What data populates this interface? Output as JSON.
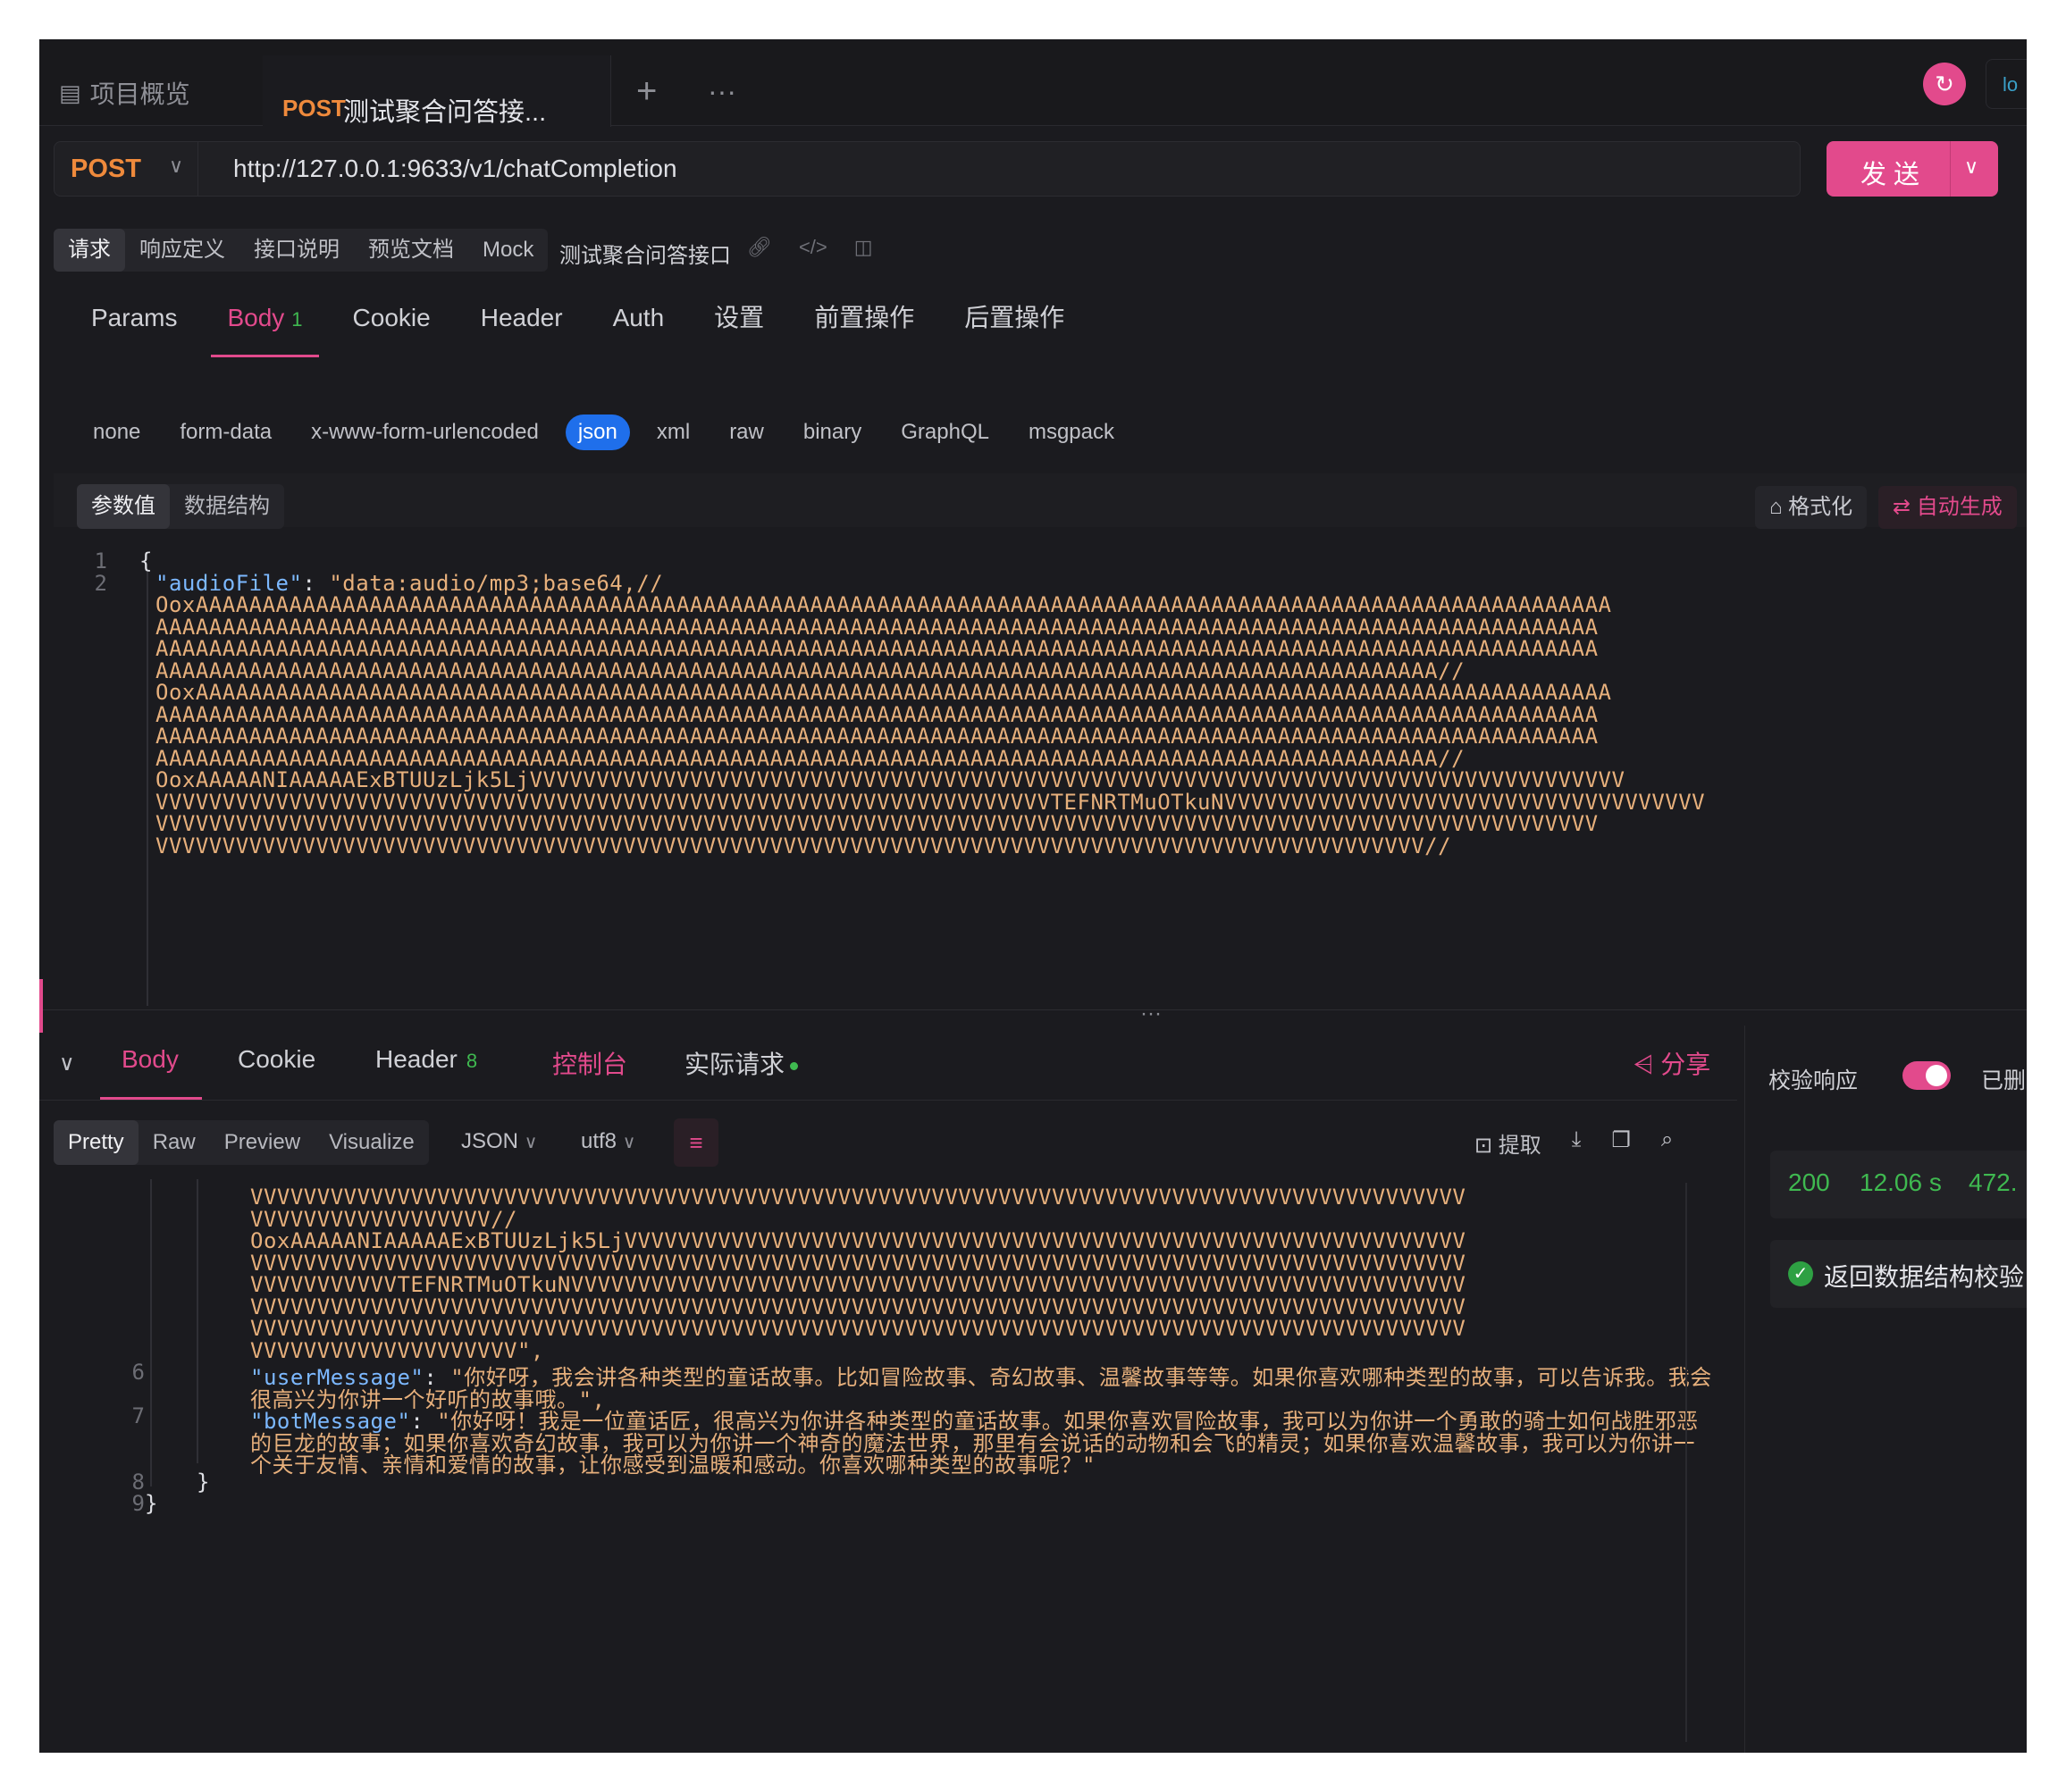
{
  "tabs": {
    "overview": "项目概览",
    "active_method": "POST",
    "active_title": "测试聚合问答接..."
  },
  "request": {
    "method": "POST",
    "url": "http://127.0.0.1:9633/v1/chatCompletion",
    "send_label": "发送"
  },
  "subtabs": [
    "请求",
    "响应定义",
    "接口说明",
    "预览文档",
    "Mock"
  ],
  "api_name": "测试聚合问答接口",
  "request_tabs": [
    {
      "label": "Params"
    },
    {
      "label": "Body",
      "count": "1"
    },
    {
      "label": "Cookie"
    },
    {
      "label": "Header"
    },
    {
      "label": "Auth"
    },
    {
      "label": "设置"
    },
    {
      "label": "前置操作"
    },
    {
      "label": "后置操作"
    }
  ],
  "body_types": [
    "none",
    "form-data",
    "x-www-form-urlencoded",
    "json",
    "xml",
    "raw",
    "binary",
    "GraphQL",
    "msgpack"
  ],
  "param_tabs": [
    "参数值",
    "数据结构"
  ],
  "format_label": "格式化",
  "auto_label": "自动生成",
  "request_code": [
    {
      "n": "1",
      "text": "{"
    },
    {
      "n": "2",
      "key": "\"audioFile\"",
      "sep": ": ",
      "text": "\"data:audio/mp3;base64,//"
    },
    {
      "n": "",
      "text": "OoxAAAAAAAAAAAAAAAAAAAAAAAAAAAAAAAAAAAAAAAAAAAAAAAAAAAAAAAAAAAAAAAAAAAAAAAAAAAAAAAAAAAAAAAAAAAAAAAAAAAAAAAAAA"
    },
    {
      "n": "",
      "text": "AAAAAAAAAAAAAAAAAAAAAAAAAAAAAAAAAAAAAAAAAAAAAAAAAAAAAAAAAAAAAAAAAAAAAAAAAAAAAAAAAAAAAAAAAAAAAAAAAAAAAAAAAAAA"
    },
    {
      "n": "",
      "text": "AAAAAAAAAAAAAAAAAAAAAAAAAAAAAAAAAAAAAAAAAAAAAAAAAAAAAAAAAAAAAAAAAAAAAAAAAAAAAAAAAAAAAAAAAAAAAAAAAAAAAAAAAAAA"
    },
    {
      "n": "",
      "text": "AAAAAAAAAAAAAAAAAAAAAAAAAAAAAAAAAAAAAAAAAAAAAAAAAAAAAAAAAAAAAAAAAAAAAAAAAAAAAAAAAAAAAAAAAAAAAAAA//"
    },
    {
      "n": "",
      "text": "OoxAAAAAAAAAAAAAAAAAAAAAAAAAAAAAAAAAAAAAAAAAAAAAAAAAAAAAAAAAAAAAAAAAAAAAAAAAAAAAAAAAAAAAAAAAAAAAAAAAAAAAAAAAA"
    },
    {
      "n": "",
      "text": "AAAAAAAAAAAAAAAAAAAAAAAAAAAAAAAAAAAAAAAAAAAAAAAAAAAAAAAAAAAAAAAAAAAAAAAAAAAAAAAAAAAAAAAAAAAAAAAAAAAAAAAAAAAA"
    },
    {
      "n": "",
      "text": "AAAAAAAAAAAAAAAAAAAAAAAAAAAAAAAAAAAAAAAAAAAAAAAAAAAAAAAAAAAAAAAAAAAAAAAAAAAAAAAAAAAAAAAAAAAAAAAAAAAAAAAAAAAA"
    },
    {
      "n": "",
      "text": "AAAAAAAAAAAAAAAAAAAAAAAAAAAAAAAAAAAAAAAAAAAAAAAAAAAAAAAAAAAAAAAAAAAAAAAAAAAAAAAAAAAAAAAAAAAAAAAA//"
    },
    {
      "n": "",
      "text": "OoxAAAAANIAAAAAExBTUUzLjk5LjVVVVVVVVVVVVVVVVVVVVVVVVVVVVVVVVVVVVVVVVVVVVVVVVVVVVVVVVVVVVVVVVVVVVVVVVVVVVVVVVVV"
    },
    {
      "n": "",
      "text": "VVVVVVVVVVVVVVVVVVVVVVVVVVVVVVVVVVVVVVVVVVVVVVVVVVVVVVVVVVVVVVVVVVVTEFNRTMuOTkuNVVVVVVVVVVVVVVVVVVVVVVVVVVVVVVVVVVVV"
    },
    {
      "n": "",
      "text": "VVVVVVVVVVVVVVVVVVVVVVVVVVVVVVVVVVVVVVVVVVVVVVVVVVVVVVVVVVVVVVVVVVVVVVVVVVVVVVVVVVVVVVVVVVVVVVVVVVVVVVVVVVVV"
    },
    {
      "n": "",
      "text": "VVVVVVVVVVVVVVVVVVVVVVVVVVVVVVVVVVVVVVVVVVVVVVVVVVVVVVVVVVVVVVVVVVVVVVVVVVVVVVVVVVVVVVVVVVVVVVV//"
    }
  ],
  "response_tabs": [
    {
      "label": "Body"
    },
    {
      "label": "Cookie"
    },
    {
      "label": "Header",
      "count": "8"
    },
    {
      "label": "控制台"
    },
    {
      "label": "实际请求"
    }
  ],
  "share_label": "分享",
  "format_tabs": [
    "Pretty",
    "Raw",
    "Preview",
    "Visualize"
  ],
  "format_select": "JSON",
  "charset_select": "utf8",
  "extract_label": "提取",
  "response_code": [
    {
      "n": "",
      "text": "VVVVVVVVVVVVVVVVVVVVVVVVVVVVVVVVVVVVVVVVVVVVVVVVVVVVVVVVVVVVVVVVVVVVVVVVVVVVVVVVVVVVVVVVVVV"
    },
    {
      "n": "",
      "text": "VVVVVVVVVVVVVVVVVV//"
    },
    {
      "n": "",
      "text": "OoxAAAAANIAAAAAExBTUUzLjk5LjVVVVVVVVVVVVVVVVVVVVVVVVVVVVVVVVVVVVVVVVVVVVVVVVVVVVVVVVVVVVVVV"
    },
    {
      "n": "",
      "text": "VVVVVVVVVVVVVVVVVVVVVVVVVVVVVVVVVVVVVVVVVVVVVVVVVVVVVVVVVVVVVVVVVVVVVVVVVVVVVVVVVVVVVVVVVVV"
    },
    {
      "n": "",
      "text": "VVVVVVVVVVVTEFNRTMuOTkuNVVVVVVVVVVVVVVVVVVVVVVVVVVVVVVVVVVVVVVVVVVVVVVVVVVVVVVVVVVVVVVVVVVV"
    },
    {
      "n": "",
      "text": "VVVVVVVVVVVVVVVVVVVVVVVVVVVVVVVVVVVVVVVVVVVVVVVVVVVVVVVVVVVVVVVVVVVVVVVVVVVVVVVVVVVVVVVVVVV"
    },
    {
      "n": "",
      "text": "VVVVVVVVVVVVVVVVVVVVVVVVVVVVVVVVVVVVVVVVVVVVVVVVVVVVVVVVVVVVVVVVVVVVVVVVVVVVVVVVVVVVVVVVVVV"
    },
    {
      "n": "",
      "text": "VVVVVVVVVVVVVVVVVVVV\","
    },
    {
      "n": "6",
      "key": "\"userMessage\"",
      "sep": ": ",
      "text": "\"你好呀，我会讲各种类型的童话故事。比如冒险故事、奇幻故事、温馨故事等等。如果你喜欢哪种类型的故事，可以告诉我。我会"
    },
    {
      "n": "",
      "text": "很高兴为你讲一个好听的故事哦。\","
    },
    {
      "n": "7",
      "key": "\"botMessage\"",
      "sep": ": ",
      "text": "\"你好呀！我是一位童话匠，很高兴为你讲各种类型的童话故事。如果你喜欢冒险故事，我可以为你讲一个勇敢的骑士如何战胜邪恶"
    },
    {
      "n": "",
      "text": "的巨龙的故事；如果你喜欢奇幻故事，我可以为你讲一个神奇的魔法世界，那里有会说话的动物和会飞的精灵；如果你喜欢温馨故事，我可以为你讲一"
    },
    {
      "n": "",
      "text": "个关于友情、亲情和爱情的故事，让你感受到温暖和感动。你喜欢哪种类型的故事呢？\""
    },
    {
      "n": "8",
      "text": "}"
    },
    {
      "n": "9",
      "text": "}"
    }
  ],
  "validate_label": "校验响应",
  "deleted_label": "已删除",
  "stats": {
    "status": "200",
    "time": "12.06 s",
    "size": "472."
  },
  "schema_label": "返回数据结构校验"
}
